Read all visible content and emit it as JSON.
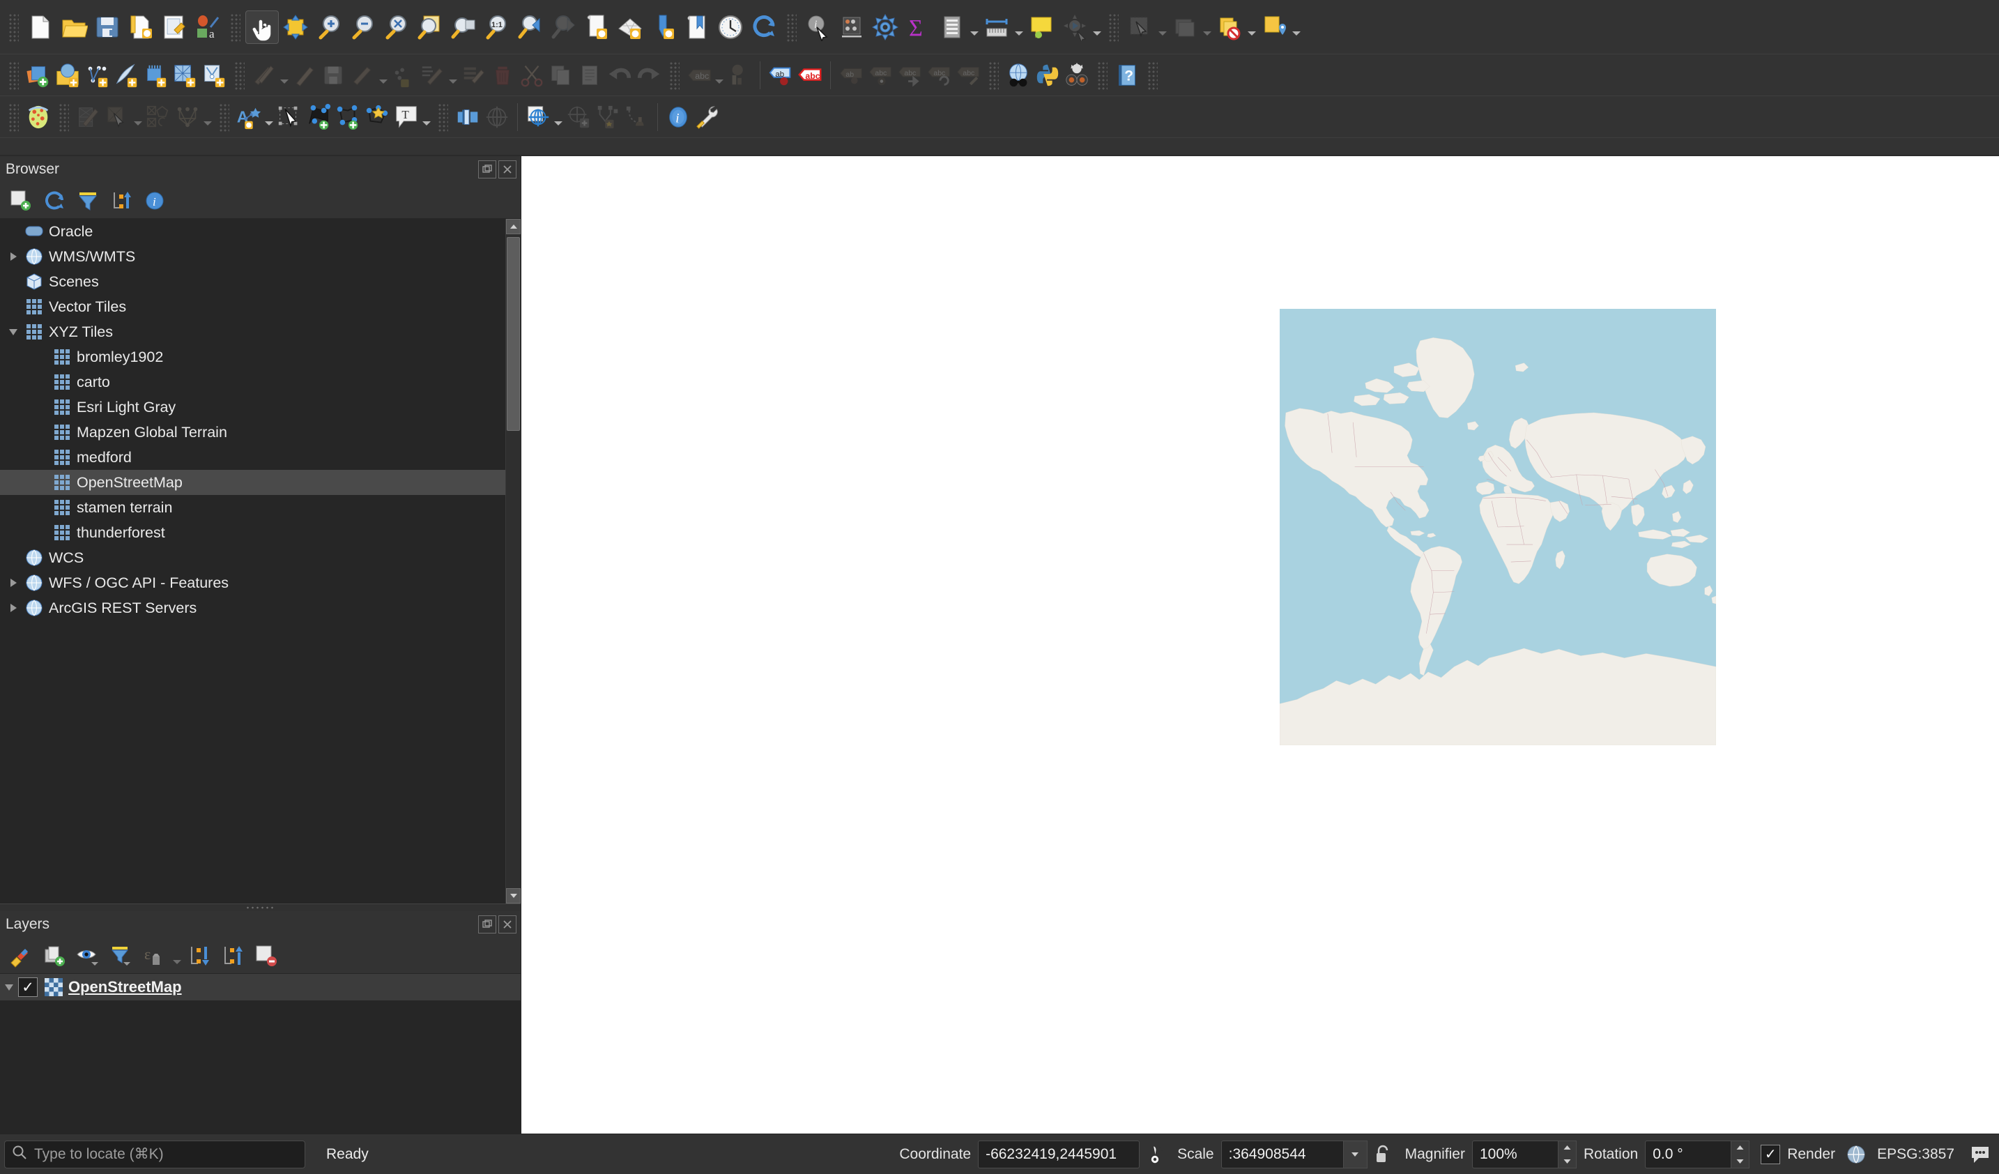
{
  "app": {
    "name": "QGIS"
  },
  "toolbars": {
    "row1": [
      {
        "icon": "new-project-icon",
        "label": "New Project"
      },
      {
        "icon": "open-project-icon",
        "label": "Open Project"
      },
      {
        "icon": "save-project-icon",
        "label": "Save Project"
      },
      {
        "icon": "new-print-layout-icon",
        "label": "New Print Layout"
      },
      {
        "icon": "layout-manager-icon",
        "label": "Layout Manager"
      },
      {
        "icon": "style-manager-icon",
        "label": "Style Manager"
      },
      {
        "icon": "pan-map-icon",
        "label": "Pan Map",
        "active": true
      },
      {
        "icon": "pan-to-selection-icon",
        "label": "Pan Map to Selection"
      },
      {
        "icon": "zoom-in-icon",
        "label": "Zoom In"
      },
      {
        "icon": "zoom-out-icon",
        "label": "Zoom Out"
      },
      {
        "icon": "zoom-full-icon",
        "label": "Zoom Full"
      },
      {
        "icon": "zoom-selection-icon",
        "label": "Zoom To Selection"
      },
      {
        "icon": "zoom-layer-icon",
        "label": "Zoom To Layer"
      },
      {
        "icon": "zoom-native-icon",
        "label": "Zoom To Native Resolution"
      },
      {
        "icon": "zoom-last-icon",
        "label": "Zoom Last"
      },
      {
        "icon": "zoom-next-icon",
        "label": "Zoom Next"
      },
      {
        "icon": "new-map-view-icon",
        "label": "New Map View"
      },
      {
        "icon": "new-3d-map-view-icon",
        "label": "New 3D Map View"
      },
      {
        "icon": "new-elevation-profile-icon",
        "label": "New Elevation Profile"
      },
      {
        "icon": "show-bookmarks-icon",
        "label": "Show Bookmarks"
      },
      {
        "icon": "temporal-controller-icon",
        "label": "Temporal Controller Panel"
      },
      {
        "icon": "refresh-icon",
        "label": "Refresh"
      },
      {
        "icon": "identify-features-icon",
        "label": "Identify Features"
      },
      {
        "icon": "statistical-summary-icon",
        "label": "Statistical Summary"
      },
      {
        "icon": "processing-toolbox-icon",
        "label": "Processing Toolbox"
      },
      {
        "icon": "field-calculator-icon",
        "label": "Field Calculator"
      },
      {
        "icon": "attribute-table-icon",
        "label": "Open Attribute Table"
      },
      {
        "icon": "measure-line-icon",
        "label": "Measure Line"
      },
      {
        "icon": "map-tips-icon",
        "label": "Show Map Tips"
      },
      {
        "icon": "run-model-icon",
        "label": "Run Model"
      },
      {
        "icon": "select-features-icon",
        "label": "Select Features"
      },
      {
        "icon": "deselect-icon",
        "label": "Deselect Features"
      },
      {
        "icon": "select-by-expression-icon",
        "label": "Select By Expression"
      },
      {
        "icon": "select-by-location-icon",
        "label": "Select By Location"
      }
    ],
    "row2": [
      {
        "icon": "add-layer-icon",
        "label": "Open Data Source Manager"
      },
      {
        "icon": "add-vector-layer-icon",
        "label": "Add Vector Layer"
      },
      {
        "icon": "add-delimited-text-icon",
        "label": "Add Delimited Text Layer"
      },
      {
        "icon": "add-spatialite-icon",
        "label": "Add SpatiaLite Layer"
      },
      {
        "icon": "add-postgis-icon",
        "label": "Add PostGIS Layer"
      },
      {
        "icon": "add-mssql-icon",
        "label": "Add MS SQL Server Layer"
      },
      {
        "icon": "add-oracle-icon",
        "label": "Add Oracle Spatial Layer"
      },
      {
        "icon": "current-edits-icon",
        "label": "Current Edits"
      },
      {
        "icon": "toggle-editing-icon",
        "label": "Toggle Editing"
      },
      {
        "icon": "save-layer-edits-icon",
        "label": "Save Layer Edits"
      },
      {
        "icon": "add-feature-icon",
        "label": "Add Feature"
      },
      {
        "icon": "vertex-tool-icon",
        "label": "Vertex Tool"
      },
      {
        "icon": "modify-attributes-icon",
        "label": "Modify Attributes of Features"
      },
      {
        "icon": "delete-selected-icon",
        "label": "Delete Selected"
      },
      {
        "icon": "cut-features-icon",
        "label": "Cut Features"
      },
      {
        "icon": "copy-features-icon",
        "label": "Copy Features"
      },
      {
        "icon": "paste-features-icon",
        "label": "Paste Features"
      },
      {
        "icon": "undo-icon",
        "label": "Undo"
      },
      {
        "icon": "redo-icon",
        "label": "Redo"
      },
      {
        "icon": "label-layer-icon",
        "label": "Layer Labeling Options"
      },
      {
        "icon": "diagram-layer-icon",
        "label": "Layer Diagram Options"
      },
      {
        "icon": "highlight-pinned-labels-icon",
        "label": "Highlight Pinned Labels"
      },
      {
        "icon": "toggle-unplaced-labels-icon",
        "label": "Toggle Display of Unplaced Labels"
      },
      {
        "icon": "pin-labels-icon",
        "label": "Pin/Unpin Labels and Diagrams"
      },
      {
        "icon": "show-hide-labels-icon",
        "label": "Show/Hide Labels and Diagrams"
      },
      {
        "icon": "move-label-icon",
        "label": "Move a Label or Diagram"
      },
      {
        "icon": "rotate-label-icon",
        "label": "Rotate a Label"
      },
      {
        "icon": "change-label-icon",
        "label": "Change Label Properties"
      },
      {
        "icon": "metasearch-icon",
        "label": "MetaSearch"
      },
      {
        "icon": "python-console-icon",
        "label": "Python Console"
      },
      {
        "icon": "plugin-manager-icon",
        "label": "Plugins"
      },
      {
        "icon": "help-icon",
        "label": "Help"
      }
    ],
    "row3": [
      {
        "icon": "style-dock-icon",
        "label": "Open Layer Styling Panel"
      },
      {
        "icon": "add-record-icon",
        "label": "Add Record"
      },
      {
        "icon": "select-element-icon",
        "label": "Select Element"
      },
      {
        "icon": "add-circular-string-icon",
        "label": "Add Circular String"
      },
      {
        "icon": "digitize-shape-icon",
        "label": "Digitize Shape"
      },
      {
        "icon": "annotation-layer-icon",
        "label": "Text Annotation"
      },
      {
        "icon": "select-annotation-icon",
        "label": "Modify Annotation"
      },
      {
        "icon": "add-point-feature-icon",
        "label": "Add Point Feature"
      },
      {
        "icon": "add-line-feature-icon",
        "label": "Add Line Feature"
      },
      {
        "icon": "add-polygon-feature-icon",
        "label": "Add Polygon Feature"
      },
      {
        "icon": "text-annotation-icon",
        "label": "Text Annotation"
      },
      {
        "icon": "georeferencer-icon",
        "label": "Georeferencer"
      },
      {
        "icon": "crs-icon",
        "label": "CRS Tools"
      },
      {
        "icon": "mesh-calculator-icon",
        "label": "Mesh Calculator"
      },
      {
        "icon": "add-mesh-point-icon",
        "label": "Add Mesh Vertex"
      },
      {
        "icon": "mesh-edit-icon",
        "label": "Edit Mesh Frame"
      },
      {
        "icon": "mesh-transform-icon",
        "label": "Transform Mesh Vertices"
      },
      {
        "icon": "about-icon",
        "label": "About"
      },
      {
        "icon": "options-icon",
        "label": "Options"
      }
    ]
  },
  "browser": {
    "title": "Browser",
    "window_buttons": [
      {
        "name": "float-panel-button",
        "glyph": "❐"
      },
      {
        "name": "close-panel-button",
        "glyph": "✕"
      }
    ],
    "toolbar": [
      {
        "icon": "add-layer-icon",
        "label": "Add Selected Layers"
      },
      {
        "icon": "refresh-icon",
        "label": "Refresh"
      },
      {
        "icon": "filter-browser-icon",
        "label": "Filter Browser"
      },
      {
        "icon": "collapse-all-icon",
        "label": "Collapse All"
      },
      {
        "icon": "properties-icon",
        "label": "Properties"
      }
    ],
    "tree": [
      {
        "label": "Oracle",
        "icon": "oracle-icon",
        "indent": 1,
        "expander": "none"
      },
      {
        "label": "WMS/WMTS",
        "icon": "globe-icon",
        "indent": 1,
        "expander": "collapsed"
      },
      {
        "label": "Scenes",
        "icon": "scenes-icon",
        "indent": 1,
        "expander": "none"
      },
      {
        "label": "Vector Tiles",
        "icon": "tiles-icon",
        "indent": 1,
        "expander": "none"
      },
      {
        "label": "XYZ Tiles",
        "icon": "tiles-icon",
        "indent": 1,
        "expander": "expanded"
      },
      {
        "label": "bromley1902",
        "icon": "tiles-icon",
        "indent": 2,
        "expander": "none"
      },
      {
        "label": "carto",
        "icon": "tiles-icon",
        "indent": 2,
        "expander": "none"
      },
      {
        "label": "Esri Light Gray",
        "icon": "tiles-icon",
        "indent": 2,
        "expander": "none"
      },
      {
        "label": "Mapzen Global Terrain",
        "icon": "tiles-icon",
        "indent": 2,
        "expander": "none"
      },
      {
        "label": "medford",
        "icon": "tiles-icon",
        "indent": 2,
        "expander": "none"
      },
      {
        "label": "OpenStreetMap",
        "icon": "tiles-icon",
        "indent": 2,
        "expander": "none",
        "selected": true
      },
      {
        "label": "stamen terrain",
        "icon": "tiles-icon",
        "indent": 2,
        "expander": "none"
      },
      {
        "label": "thunderforest",
        "icon": "tiles-icon",
        "indent": 2,
        "expander": "none"
      },
      {
        "label": "WCS",
        "icon": "globe-icon",
        "indent": 1,
        "expander": "none"
      },
      {
        "label": "WFS / OGC API - Features",
        "icon": "globe-icon",
        "indent": 1,
        "expander": "collapsed"
      },
      {
        "label": "ArcGIS REST Servers",
        "icon": "globe-icon",
        "indent": 1,
        "expander": "collapsed"
      }
    ]
  },
  "layers": {
    "title": "Layers",
    "window_buttons": [
      {
        "name": "float-panel-button",
        "glyph": "❐"
      },
      {
        "name": "close-panel-button",
        "glyph": "✕"
      }
    ],
    "toolbar": [
      {
        "icon": "open-layer-styling-icon",
        "label": "Open Layer Styling Panel"
      },
      {
        "icon": "add-group-icon",
        "label": "Add Group"
      },
      {
        "icon": "manage-visibility-icon",
        "label": "Manage Map Themes"
      },
      {
        "icon": "filter-legend-icon",
        "label": "Filter Legend"
      },
      {
        "icon": "expression-filter-icon",
        "label": "Filter Legend by Expression"
      },
      {
        "icon": "collapse-all-icon",
        "label": "Collapse All"
      },
      {
        "icon": "expand-all-icon",
        "label": "Expand All"
      },
      {
        "icon": "remove-layer-icon",
        "label": "Remove Layer/Group"
      }
    ],
    "items": [
      {
        "name": "OpenStreetMap",
        "checked": true,
        "expander": "expanded",
        "icon": "raster-layer-icon",
        "selected": true
      }
    ]
  },
  "canvas": {
    "map_layer": "OpenStreetMap",
    "water_color": "#a9d2e0",
    "land_color": "#f1eee8",
    "border_color": "#c8a8a8"
  },
  "status": {
    "locate_placeholder": "Type to locate (⌘K)",
    "locate_value": "",
    "message": "Ready",
    "coordinate_label": "Coordinate",
    "coordinate_value": "-66232419,2445901",
    "scale_label": "Scale",
    "scale_value": ":364908544",
    "magnifier_label": "Magnifier",
    "magnifier_value": "100%",
    "rotation_label": "Rotation",
    "rotation_value": "0.0 °",
    "render_label": "Render",
    "render_checked": true,
    "crs_label": "EPSG:3857",
    "messages_glyph": "•••"
  }
}
